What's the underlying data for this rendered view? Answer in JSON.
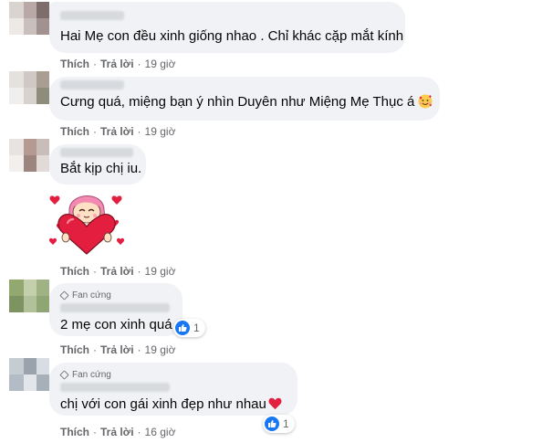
{
  "comments": [
    {
      "text": "Hai Mẹ con đều xinh giống nhao . Chỉ khác cặp mắt kính",
      "like": "Thích",
      "reply": "Trả lời",
      "time": "19 giờ"
    },
    {
      "text": "Cưng quá, miệng bạn ý nhìn Duyên như Miệng Mẹ Thục á",
      "emoji": "smiling-face-with-hearts",
      "like": "Thích",
      "reply": "Trả lời",
      "time": "19 giờ"
    },
    {
      "text": "Bắt kịp chị iu.",
      "sticker": "girl-hugging-heart-sticker",
      "like": "Thích",
      "reply": "Trả lời",
      "time": "19 giờ"
    },
    {
      "badge": "Fan cứng",
      "text": "2 mẹ con xinh quá",
      "reaction_count": "1",
      "like": "Thích",
      "reply": "Trả lời",
      "time": "19 giờ"
    },
    {
      "badge": "Fan cứng",
      "text": "chị với con gái xinh đẹp như nhau",
      "emoji": "red-heart",
      "reaction_count": "1",
      "like": "Thích",
      "reply": "Trả lời",
      "time": "16 giờ"
    }
  ],
  "colors": {
    "bubble": "#f0f2f5",
    "meta": "#65676b",
    "like_blue": "#1877f2",
    "heart_red": "#e41e3f"
  }
}
